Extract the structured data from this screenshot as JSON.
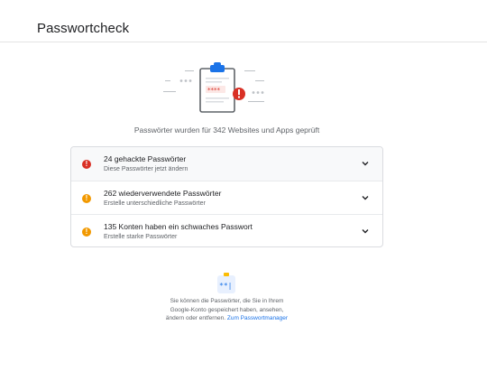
{
  "header": {
    "title": "Passwortcheck"
  },
  "summary": {
    "text": "Passwörter wurden für 342 Websites und Apps geprüft"
  },
  "hero": {
    "stars": "****"
  },
  "issues": [
    {
      "title": "24 gehackte Passwörter",
      "subtitle": "Diese Passwörter jetzt ändern",
      "severity": "critical",
      "color": "#d93025"
    },
    {
      "title": "262 wiederverwendete Passwörter",
      "subtitle": "Erstelle unterschiedliche Passwörter",
      "severity": "warning",
      "color": "#f29900"
    },
    {
      "title": "135 Konten haben ein schwaches Passwort",
      "subtitle": "Erstelle starke Passwörter",
      "severity": "warning",
      "color": "#f29900"
    }
  ],
  "promo": {
    "icon_text": "**|",
    "line1": "Sie können die Passwörter, die Sie in Ihrem",
    "line2": "Google-Konto gespeichert haben, ansehen,",
    "line3": "ändern oder entfernen. ",
    "link": "Zum Passwortmanager"
  },
  "colors": {
    "accent": "#1a73e8",
    "critical": "#d93025",
    "warning": "#f29900"
  }
}
